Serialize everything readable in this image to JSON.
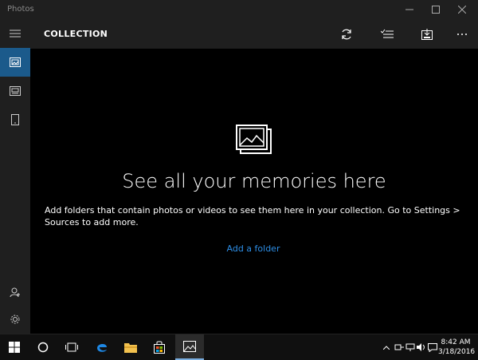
{
  "window": {
    "title": "Photos"
  },
  "appbar": {
    "title": "COLLECTION"
  },
  "main": {
    "headline": "See all your memories here",
    "description": "Add folders that contain photos or videos to see them here in your collection. Go to Settings > Sources to add more.",
    "add_folder_link": "Add a folder",
    "scroll_hint": "..."
  },
  "taskbar": {
    "time": "8:42 AM",
    "date": "3/18/2016"
  },
  "colors": {
    "accent": "#1b5a8b",
    "link": "#2d8ee6",
    "chrome": "#1f1f1f"
  }
}
